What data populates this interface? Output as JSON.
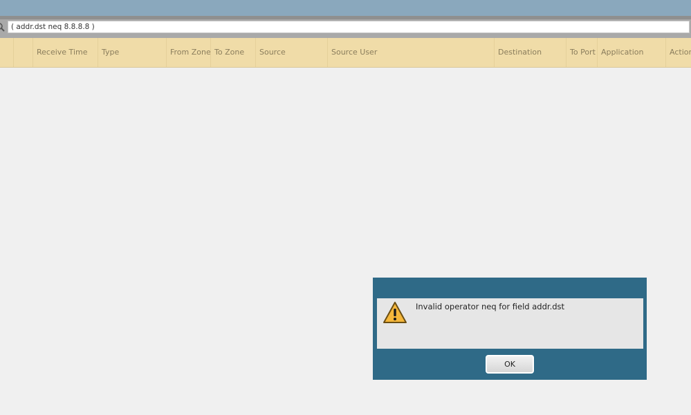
{
  "filter": {
    "query": "( addr.dst neq 8.8.8.8 )"
  },
  "table": {
    "columns": [
      "",
      "",
      "Receive Time",
      "Type",
      "From Zone",
      "To Zone",
      "Source",
      "Source User",
      "Destination",
      "To Port",
      "Application",
      "Action"
    ]
  },
  "dialog": {
    "message": "Invalid operator neq for field addr.dst",
    "ok_label": "OK",
    "icon": "warning-icon"
  },
  "colors": {
    "topbar": "#8aa8bd",
    "header": "#f0dca8",
    "dialog_frame": "#2f6a87",
    "warning": "#f5b73b"
  }
}
